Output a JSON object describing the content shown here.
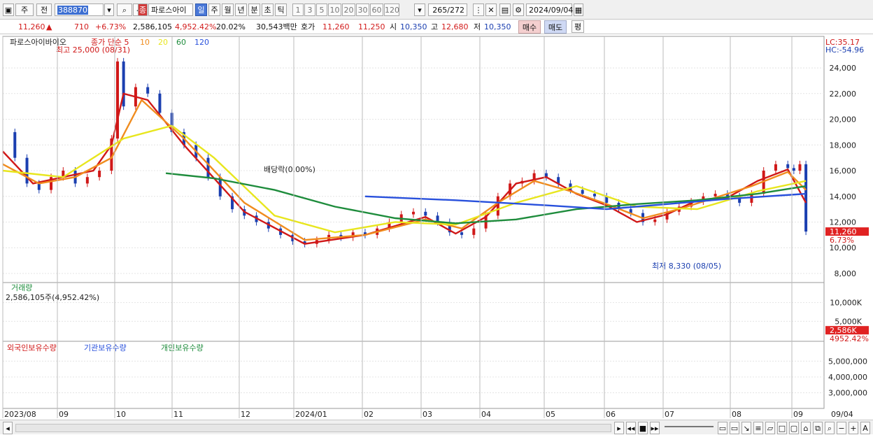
{
  "toolbar": {
    "period_sel": "주",
    "prev_label": "전",
    "code": "388870",
    "badge": "종",
    "name": "파로스아이",
    "periods": [
      "일",
      "주",
      "월",
      "년",
      "분",
      "초",
      "틱"
    ],
    "intervals": [
      "1",
      "3",
      "5",
      "10",
      "20",
      "30",
      "60",
      "120"
    ],
    "counter": "265",
    "counter_total": "/272",
    "date": "2024/09/04"
  },
  "quote": {
    "price": "11,260",
    "arrow": "▲",
    "change": "710",
    "change_pct": "+6.73%",
    "volume": "2,586,105",
    "volume_pct": "4,952.42%",
    "turnover": "20.02%",
    "amount": "30,543백만",
    "bid_label": "호가",
    "bid1": "11,260",
    "bid2": "11,250",
    "open_label": "시",
    "open": "10,350",
    "high_label": "고",
    "high": "12,680",
    "low_label": "저",
    "low": "10,350",
    "buy": "매수",
    "sell": "매도",
    "eval": "평"
  },
  "chart_data": [
    {
      "type": "line",
      "name": "price",
      "title": "파로스아이바이오",
      "legend": [
        {
          "label": "종가 단순 5",
          "color": "#d01818"
        },
        {
          "label": "10",
          "color": "#f08c1e"
        },
        {
          "label": "20",
          "color": "#e8e61e"
        },
        {
          "label": "60",
          "color": "#1e8c3c"
        },
        {
          "label": "120",
          "color": "#2850dc"
        }
      ],
      "lc_label": "LC:35.17",
      "hc_label": "HC:-54.96",
      "yticks": [
        "24,000",
        "22,000",
        "20,000",
        "18,000",
        "16,000",
        "14,000",
        "12,000",
        "10,000",
        "8,000"
      ],
      "ylim": [
        7400,
        25800
      ],
      "annotations": {
        "high": "최고 25,000 (08/31)",
        "low": "최저 8,330 (08/05)",
        "dividend": "배당락(0.00%)"
      },
      "last_price_label": "11,260",
      "last_change_label": "6.73%",
      "x_count": 272,
      "series": [
        {
          "name": "close",
          "color": "#d01818",
          "points": [
            [
              0,
              19000
            ],
            [
              4,
              17000
            ],
            [
              8,
              15000
            ],
            [
              12,
              14500
            ],
            [
              16,
              15500
            ],
            [
              20,
              16000
            ],
            [
              24,
              15000
            ],
            [
              28,
              15500
            ],
            [
              32,
              16000
            ],
            [
              36,
              18500
            ],
            [
              38,
              24500
            ],
            [
              40,
              21000
            ],
            [
              44,
              22500
            ],
            [
              48,
              22000
            ],
            [
              52,
              20500
            ],
            [
              56,
              19000
            ],
            [
              60,
              18000
            ],
            [
              64,
              17000
            ],
            [
              68,
              15500
            ],
            [
              72,
              14000
            ],
            [
              76,
              13000
            ],
            [
              80,
              12500
            ],
            [
              84,
              12000
            ],
            [
              88,
              11500
            ],
            [
              92,
              11000
            ],
            [
              96,
              10500
            ],
            [
              100,
              10300
            ],
            [
              104,
              10600
            ],
            [
              108,
              11000
            ],
            [
              112,
              10800
            ],
            [
              116,
              11200
            ],
            [
              120,
              11000
            ],
            [
              124,
              11500
            ],
            [
              128,
              12000
            ],
            [
              132,
              12600
            ],
            [
              136,
              12800
            ],
            [
              140,
              12500
            ],
            [
              144,
              12000
            ],
            [
              148,
              11200
            ],
            [
              152,
              11000
            ],
            [
              156,
              11500
            ],
            [
              160,
              12500
            ],
            [
              164,
              14000
            ],
            [
              168,
              15000
            ],
            [
              172,
              15200
            ],
            [
              176,
              15800
            ],
            [
              180,
              15500
            ],
            [
              184,
              15000
            ],
            [
              188,
              14500
            ],
            [
              192,
              14200
            ],
            [
              196,
              14000
            ],
            [
              200,
              13500
            ],
            [
              204,
              13000
            ],
            [
              208,
              12700
            ],
            [
              212,
              12000
            ],
            [
              216,
              12200
            ],
            [
              220,
              12800
            ],
            [
              224,
              13200
            ],
            [
              228,
              13600
            ],
            [
              232,
              14000
            ],
            [
              236,
              14200
            ],
            [
              240,
              14000
            ],
            [
              244,
              13500
            ],
            [
              248,
              14200
            ],
            [
              252,
              16000
            ],
            [
              256,
              16500
            ],
            [
              260,
              16200
            ],
            [
              262,
              16000
            ],
            [
              264,
              16500
            ],
            [
              266,
              11260
            ]
          ]
        },
        {
          "name": "ma5",
          "color": "#d01818",
          "points": [
            [
              0,
              17500
            ],
            [
              10,
              15000
            ],
            [
              20,
              15500
            ],
            [
              30,
              16000
            ],
            [
              36,
              18000
            ],
            [
              40,
              22000
            ],
            [
              48,
              21500
            ],
            [
              60,
              18000
            ],
            [
              80,
              12800
            ],
            [
              100,
              10300
            ],
            [
              120,
              11000
            ],
            [
              140,
              12400
            ],
            [
              150,
              11100
            ],
            [
              160,
              12400
            ],
            [
              170,
              15000
            ],
            [
              180,
              15500
            ],
            [
              190,
              14200
            ],
            [
              200,
              13300
            ],
            [
              210,
              12000
            ],
            [
              220,
              12600
            ],
            [
              230,
              13700
            ],
            [
              240,
              13900
            ],
            [
              250,
              15200
            ],
            [
              260,
              16100
            ],
            [
              266,
              13500
            ]
          ]
        },
        {
          "name": "ma10",
          "color": "#f08c1e",
          "points": [
            [
              0,
              16500
            ],
            [
              12,
              15000
            ],
            [
              24,
              15500
            ],
            [
              36,
              17000
            ],
            [
              46,
              21500
            ],
            [
              60,
              18500
            ],
            [
              80,
              13500
            ],
            [
              100,
              10600
            ],
            [
              120,
              11000
            ],
            [
              140,
              12200
            ],
            [
              152,
              11500
            ],
            [
              164,
              13500
            ],
            [
              176,
              15200
            ],
            [
              188,
              14400
            ],
            [
              200,
              13400
            ],
            [
              212,
              12300
            ],
            [
              224,
              13000
            ],
            [
              236,
              13900
            ],
            [
              248,
              14800
            ],
            [
              260,
              15900
            ],
            [
              266,
              14500
            ]
          ]
        },
        {
          "name": "ma20",
          "color": "#e8e61e",
          "points": [
            [
              0,
              16000
            ],
            [
              20,
              15500
            ],
            [
              40,
              18500
            ],
            [
              56,
              19500
            ],
            [
              70,
              17000
            ],
            [
              90,
              12500
            ],
            [
              110,
              11200
            ],
            [
              130,
              12000
            ],
            [
              150,
              11800
            ],
            [
              170,
              13500
            ],
            [
              190,
              14800
            ],
            [
              210,
              13200
            ],
            [
              230,
              13000
            ],
            [
              250,
              14400
            ],
            [
              266,
              15200
            ]
          ]
        },
        {
          "name": "ma60",
          "color": "#1e8c3c",
          "points": [
            [
              54,
              15800
            ],
            [
              70,
              15400
            ],
            [
              90,
              14500
            ],
            [
              110,
              13200
            ],
            [
              130,
              12300
            ],
            [
              150,
              11900
            ],
            [
              170,
              12200
            ],
            [
              190,
              13000
            ],
            [
              210,
              13400
            ],
            [
              230,
              13700
            ],
            [
              250,
              14200
            ],
            [
              266,
              14800
            ]
          ]
        },
        {
          "name": "ma120",
          "color": "#2850dc",
          "points": [
            [
              120,
              14000
            ],
            [
              150,
              13700
            ],
            [
              180,
              13300
            ],
            [
              200,
              13000
            ],
            [
              220,
              13400
            ],
            [
              240,
              13800
            ],
            [
              266,
              14200
            ]
          ]
        }
      ]
    },
    {
      "type": "bar",
      "name": "volume",
      "title": "거래량",
      "subtitle": "2,586,105주(4,952.42%)",
      "yticks": [
        "10,000K",
        "5,000K"
      ],
      "ylim": [
        0,
        12000000
      ],
      "last_label": "2,586K",
      "last_pct_label": "4952.42%"
    },
    {
      "type": "line",
      "name": "holdings",
      "legend": [
        {
          "label": "외국인보유수량",
          "color": "#d01818"
        },
        {
          "label": "기관보유수량",
          "color": "#2850dc"
        },
        {
          "label": "개인보유수량",
          "color": "#1e8c3c"
        }
      ],
      "yticks": [
        "5,000,000",
        "4,000,000",
        "3,000,000"
      ],
      "ylim": [
        2100000,
        5900000
      ],
      "x_labels": [
        "2023/08",
        "09",
        "10",
        "11",
        "12",
        "2024/01",
        "02",
        "03",
        "04",
        "05",
        "06",
        "07",
        "08",
        "09",
        "09/04"
      ]
    }
  ]
}
